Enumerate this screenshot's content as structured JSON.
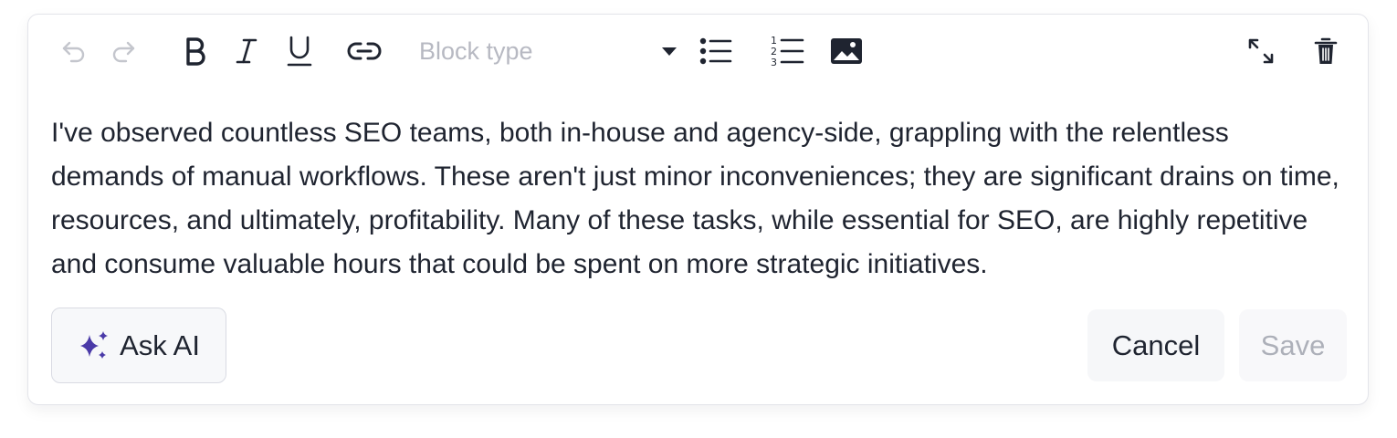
{
  "toolbar": {
    "buttons": [
      {
        "name": "undo-icon",
        "state": "disabled"
      },
      {
        "name": "redo-icon",
        "state": "disabled"
      },
      {
        "name": "bold-icon"
      },
      {
        "name": "italic-icon"
      },
      {
        "name": "underline-icon"
      },
      {
        "name": "link-icon"
      },
      {
        "name": "bulleted-list-icon"
      },
      {
        "name": "numbered-list-icon"
      },
      {
        "name": "image-icon"
      },
      {
        "name": "expand-icon"
      },
      {
        "name": "trash-icon"
      }
    ],
    "block_type_placeholder": "Block type"
  },
  "content": {
    "text": "I've observed countless SEO teams, both in-house and agency-side, grappling with the relentless demands of manual workflows. These aren't just minor inconveniences; they are significant drains on time, resources, and ultimately, profitability. Many of these tasks, while essential for SEO, are highly repetitive and consume valuable hours that could be spent on more strategic initiatives."
  },
  "footer": {
    "ask_ai_label": "Ask AI",
    "ask_ai_icon": "sparkles-icon",
    "cancel_label": "Cancel",
    "save_label": "Save",
    "save_state": "disabled"
  },
  "colors": {
    "text": "#1f2430",
    "muted": "#b7b9c2",
    "accent_ai": "#4a3aa8",
    "border": "#e3e4ea"
  }
}
